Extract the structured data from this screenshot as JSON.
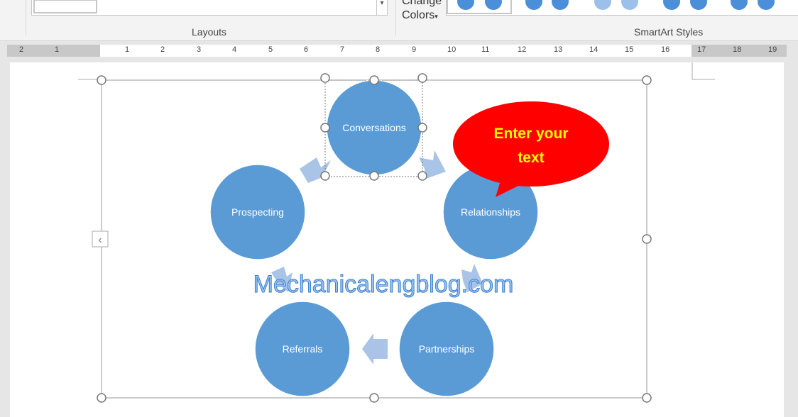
{
  "ribbon": {
    "change_colors_top": "Change",
    "change_colors": "Colors",
    "layouts_label": "Layouts",
    "smartart_styles_label": "SmartArt Styles"
  },
  "ruler": {
    "labels": [
      "2",
      "1",
      "1",
      "2",
      "3",
      "4",
      "5",
      "6",
      "7",
      "8",
      "9",
      "10",
      "11",
      "12",
      "13",
      "14",
      "15",
      "16",
      "17",
      "18",
      "19"
    ]
  },
  "diagram": {
    "nodes": [
      "Conversations",
      "Relationships",
      "Partnerships",
      "Referrals",
      "Prospecting"
    ],
    "circle_color": "#5b9bd5",
    "arrow_color": "#a9c4e6"
  },
  "callout": {
    "line1": "Enter your",
    "line2": "text",
    "fill": "#ff0000",
    "text_color": "#ffff00"
  },
  "watermark": "Mechanicalengblog.com"
}
